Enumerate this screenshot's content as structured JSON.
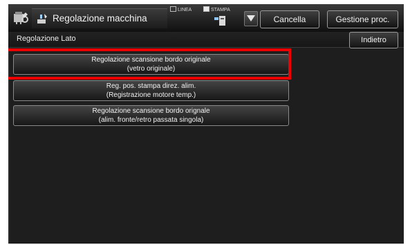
{
  "header": {
    "title": "Regolazione macchina",
    "mode_linea": "LINEA",
    "mode_stampa": "STAMPA",
    "cancel_label": "Cancella",
    "jobs_label": "Gestione proc."
  },
  "subheader": {
    "title": "Regolazione Lato",
    "back_label": "Indietro"
  },
  "items": [
    {
      "line1": "Regolazione scansione bordo originale",
      "line2": "(vetro originale)",
      "highlighted": true
    },
    {
      "line1": "Reg. pos. stampa direz. alim.",
      "line2": "(Registrazione motore temp.)",
      "highlighted": false
    },
    {
      "line1": "Regolazione scansione bordo orignale",
      "line2": "(alim. fronte/retro passata singola)",
      "highlighted": false
    }
  ],
  "colors": {
    "highlight": "#ee0000",
    "background": "#1e1e1e"
  },
  "icons": [
    "machine-icon",
    "adjust-icon",
    "stampa-icon",
    "dropdown-arrow-icon"
  ]
}
